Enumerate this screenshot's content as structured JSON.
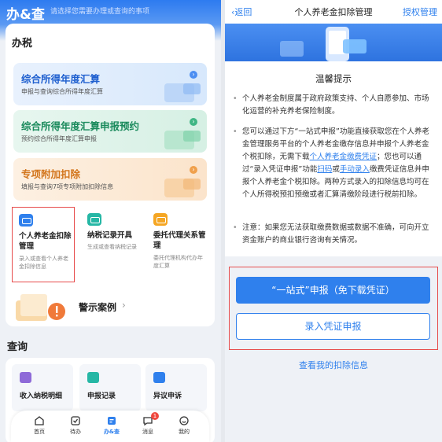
{
  "left": {
    "logo": "办&查",
    "search_placeholder": "请选择您需要办理或查询的事项",
    "tax_section_title": "办税",
    "banners": [
      {
        "title": "综合所得年度汇算",
        "subtitle": "申报与查询综合所得年度汇算"
      },
      {
        "title": "综合所得年度汇算申报预约",
        "subtitle": "预约综合所得年度汇算申报"
      },
      {
        "title": "专项附加扣除",
        "subtitle": "填报与查询7项专项附加扣除信息"
      }
    ],
    "tiles": [
      {
        "title": "个人养老金扣除管理",
        "desc": "录入或查看个人养老金扣除信息"
      },
      {
        "title": "纳税记录开具",
        "desc": "生成或查看纳税记录"
      },
      {
        "title": "委托代理关系管理",
        "desc": "委托代理机构代办年度汇算"
      }
    ],
    "warning_cases": "警示案例",
    "query_section_title": "查询",
    "query_items": [
      "收入纳税明细",
      "申报记录",
      "异议申诉"
    ],
    "tabs": [
      {
        "label": "首页"
      },
      {
        "label": "待办"
      },
      {
        "label": "办&查"
      },
      {
        "label": "消息",
        "badge": "1"
      },
      {
        "label": "我的"
      }
    ]
  },
  "right": {
    "nav": {
      "back": "返回",
      "title": "个人养老金扣除管理",
      "manage": "授权管理"
    },
    "notice_title": "温馨提示",
    "p1": "个人养老金制度属于政府政策支持、个人自愿参加、市场化运营的补充养老保险制度。",
    "p2_a": "您可以通过下方“一站式申报”功能直接获取您在个人养老金管理服务平台的个人养老金缴存信息并申报个人养老金个税扣除，无需下载",
    "p2_link1": "个人养老金缴费凭证",
    "p2_b": "；您也可以通过“录入凭证申报”功能",
    "p2_link2": "扫码",
    "p2_c": "或",
    "p2_link3": "手动录入",
    "p2_d": "缴费凭证信息并申报个人养老金个税扣除。两种方式录入的扣除信息均可在个人所得税预扣预缴或者汇算清缴阶段进行税前扣除。",
    "p3": "注意：如果您无法获取缴费数据或数据不准确，可向开立资金账户的商业银行咨询有关情况。",
    "btn_primary": "“一站式”申报（免下载凭证）",
    "btn_secondary": "录入凭证申报",
    "view_link": "查看我的扣除信息"
  }
}
